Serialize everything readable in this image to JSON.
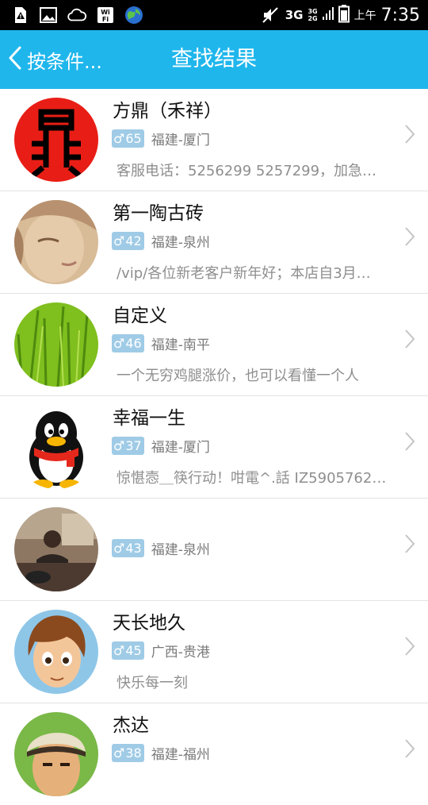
{
  "status_bar": {
    "network": "3G",
    "signal_top": "3G",
    "signal_bottom": "2G",
    "ampm": "上午",
    "time": "7:35",
    "icons": [
      "warning-sim-icon",
      "image-icon",
      "cloud-icon",
      "wifi-icon",
      "globe-icon",
      "mute-icon",
      "battery-icon"
    ]
  },
  "header": {
    "back_label": "按条件...",
    "title": "查找结果",
    "background": "#1fb6ec"
  },
  "results": [
    {
      "name": "方鼎（禾祥）",
      "gender": "♂",
      "age": "65",
      "location": "福建-厦门",
      "signature": "客服电话：5256299 5257299，加急…"
    },
    {
      "name": "第一陶古砖",
      "gender": "♂",
      "age": "42",
      "location": "福建-泉州",
      "signature": "/vip/各位新老客户新年好；本店自3月…"
    },
    {
      "name": "自定义",
      "gender": "♂",
      "age": "46",
      "location": "福建-南平",
      "signature": "一个无穷鸡腿涨价，也可以看懂一个人"
    },
    {
      "name": "幸福一生",
      "gender": "♂",
      "age": "37",
      "location": "福建-厦门",
      "signature": "惊愖悫＿筷行动！咁電^.話 IZ5905762…"
    },
    {
      "name": "",
      "gender": "♂",
      "age": "43",
      "location": "福建-泉州",
      "signature": ""
    },
    {
      "name": "天长地久",
      "gender": "♂",
      "age": "45",
      "location": "广西-贵港",
      "signature": "快乐每一刻"
    },
    {
      "name": "杰达",
      "gender": "♂",
      "age": "38",
      "location": "福建-福州",
      "signature": ""
    }
  ]
}
